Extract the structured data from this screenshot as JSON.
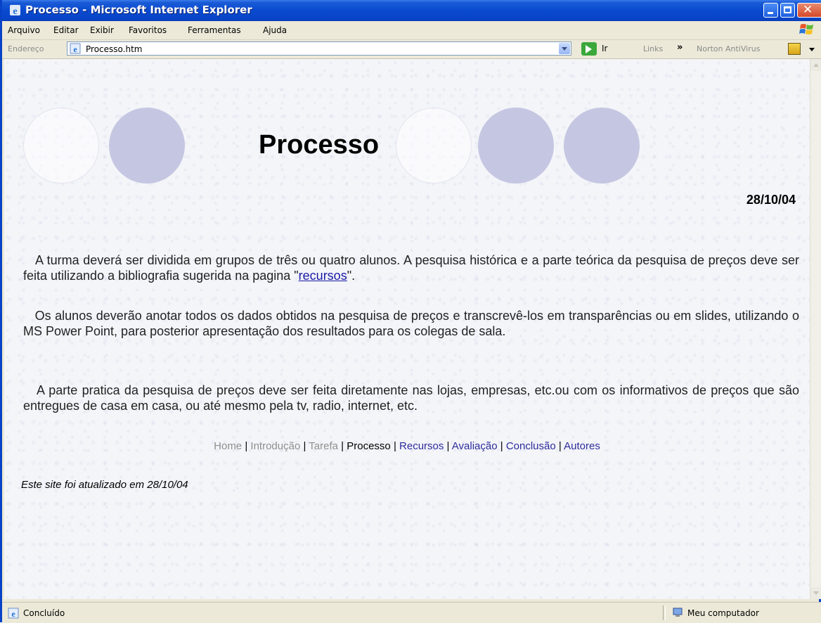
{
  "window": {
    "title": "Processo - Microsoft Internet Explorer",
    "title_icon": "ie-icon",
    "close_glyph": "✕"
  },
  "menu": {
    "items": [
      "Arquivo",
      "Editar",
      "Exibir",
      "Favoritos",
      "Ferramentas",
      "Ajuda"
    ]
  },
  "address_bar": {
    "label": "Endereço",
    "value": "Processo.htm",
    "go_label": "Ir",
    "links_label": "Links",
    "chevron": "»",
    "norton_label": "Norton AntiVirus"
  },
  "page": {
    "title": "Processo",
    "date": "28/10/04",
    "paragraph1_before_link": "A turma deverá ser dividida em grupos de três ou quatro alunos. A pesquisa histórica e a parte teórica da pesquisa de preços deve ser feita utilizando a bibliografia sugerida na pagina \"",
    "paragraph1_link": "recursos",
    "paragraph1_after_link": "\".",
    "paragraph2": "Os alunos deverão anotar todos os dados obtidos na pesquisa de preços  e transcrevê-los em transparências ou em slides, utilizando o MS Power Point, para posterior apresentação dos resultados para os colegas de sala.",
    "paragraph3": "A parte pratica da pesquisa de preços deve ser feita diretamente nas lojas, empresas, etc.ou com os informativos de preços que são entregues de casa em casa, ou até mesmo pela tv, radio, internet, etc.",
    "nav": {
      "separator": "|",
      "items": [
        "Home",
        "Introdução",
        "Tarefa",
        "Processo",
        "Recursos",
        "Avaliação",
        "Conclusão",
        "Autores"
      ]
    },
    "footer_note": "Este site foi atualizado em 28/10/04"
  },
  "status_bar": {
    "status": "Concluído",
    "zone": "Meu computador"
  },
  "colors": {
    "titlebar": "#0a4ad0",
    "circle_fill": "#c5c7e2",
    "link": "#2b2b9a",
    "muted_link": "#8e8e8e"
  }
}
